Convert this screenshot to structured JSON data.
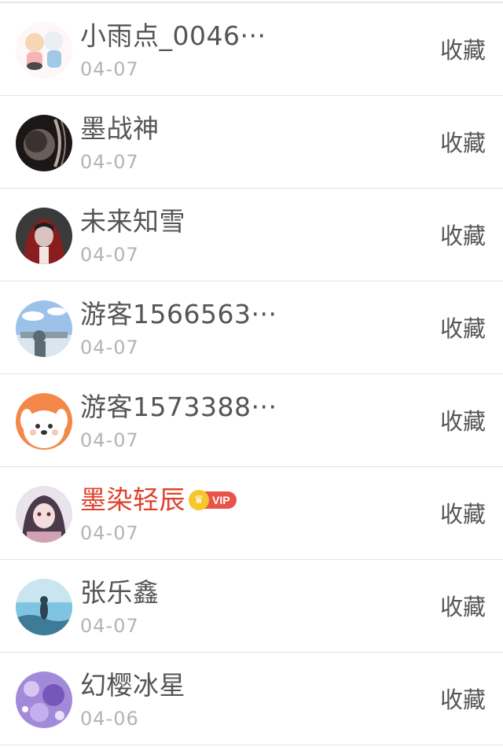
{
  "list": {
    "items": [
      {
        "name": "小雨点_0046···",
        "date": "04-07",
        "action": "收藏",
        "vip": false,
        "avatar_icon": "avatar-anime-duo-icon",
        "colors": [
          "#fbeff0",
          "#f6d6b3",
          "#9fc9e6"
        ]
      },
      {
        "name": "墨战神",
        "date": "04-07",
        "action": "收藏",
        "vip": false,
        "avatar_icon": "avatar-dark-planet-icon",
        "colors": [
          "#1b1717",
          "#6b5e5a",
          "#b9a79f"
        ]
      },
      {
        "name": "未来知雪",
        "date": "04-07",
        "action": "收藏",
        "vip": false,
        "avatar_icon": "avatar-red-hood-icon",
        "colors": [
          "#3a3a3a",
          "#8a1d1d",
          "#d7c3bf"
        ]
      },
      {
        "name": "游客1566563···",
        "date": "04-07",
        "action": "收藏",
        "vip": false,
        "avatar_icon": "avatar-sky-photo-icon",
        "colors": [
          "#9cc2ea",
          "#d9e5ef",
          "#5b6b74"
        ]
      },
      {
        "name": "游客1573388···",
        "date": "04-07",
        "action": "收藏",
        "vip": false,
        "avatar_icon": "avatar-cartoon-dog-icon",
        "colors": [
          "#f3884a",
          "#ffffff",
          "#f6c7b3"
        ]
      },
      {
        "name": "墨染轻辰",
        "date": "04-07",
        "action": "收藏",
        "vip": true,
        "vip_label": "VIP",
        "avatar_icon": "avatar-anime-girl-icon",
        "colors": [
          "#e9e4ec",
          "#4a3a4a",
          "#d1a2b4"
        ]
      },
      {
        "name": "张乐鑫",
        "date": "04-07",
        "action": "收藏",
        "vip": false,
        "avatar_icon": "avatar-sea-photo-icon",
        "colors": [
          "#7fc5e2",
          "#3d7b97",
          "#c9e6f0"
        ]
      },
      {
        "name": "幻樱冰星",
        "date": "04-06",
        "action": "收藏",
        "vip": false,
        "avatar_icon": "avatar-purple-galaxy-icon",
        "colors": [
          "#a38ad9",
          "#d7c8f3",
          "#7457b8"
        ]
      }
    ]
  }
}
